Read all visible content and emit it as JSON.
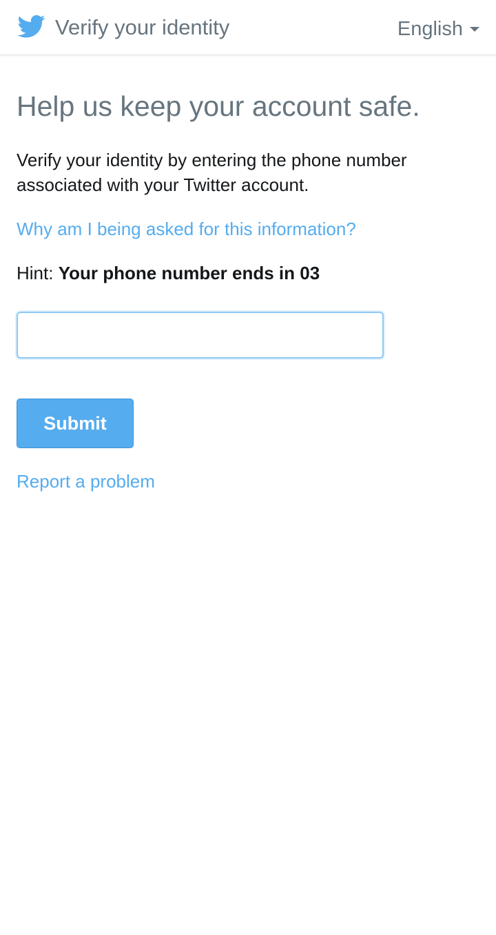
{
  "header": {
    "title": "Verify your identity",
    "language": "English",
    "logo_icon": "twitter-bird-icon"
  },
  "main": {
    "headline": "Help us keep your account safe.",
    "intro": "Verify your identity by entering the phone number associated with your Twitter account.",
    "why_link": "Why am I being asked for this information?",
    "hint_label": "Hint:",
    "hint_value": "Your phone number ends in 03",
    "phone_input_value": "",
    "submit_label": "Submit",
    "report_link": "Report a problem"
  },
  "colors": {
    "brand": "#55acee",
    "text_muted": "#66757f",
    "text_dark": "#14171a"
  }
}
